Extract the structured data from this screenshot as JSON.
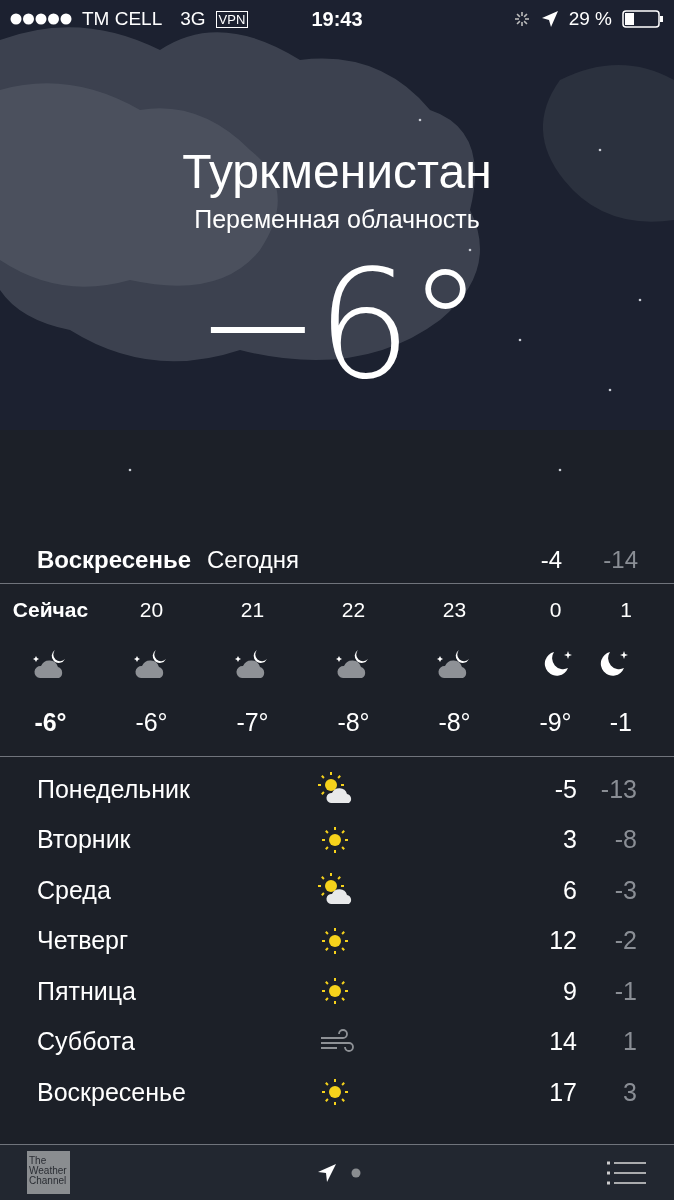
{
  "status_bar": {
    "carrier": "TM CELL",
    "network": "3G",
    "vpn": "VPN",
    "time": "19:43",
    "battery": "29 %"
  },
  "location": {
    "city": "Туркменистан",
    "condition": "Переменная облачность",
    "temperature": "−6°"
  },
  "today": {
    "day": "Воскресенье",
    "label": "Сегодня",
    "high": "-4",
    "low": "-14"
  },
  "hourly": [
    {
      "time": "Сейчас",
      "kind": "partly-cloudy-night",
      "temp": "-6°",
      "now": true
    },
    {
      "time": "20",
      "kind": "partly-cloudy-night",
      "temp": "-6°",
      "now": false
    },
    {
      "time": "21",
      "kind": "partly-cloudy-night",
      "temp": "-7°",
      "now": false
    },
    {
      "time": "22",
      "kind": "partly-cloudy-night",
      "temp": "-8°",
      "now": false
    },
    {
      "time": "23",
      "kind": "partly-cloudy-night",
      "temp": "-8°",
      "now": false
    },
    {
      "time": "0",
      "kind": "clear-night",
      "temp": "-9°",
      "now": false
    },
    {
      "time": "1",
      "kind": "clear-night",
      "temp": "-1",
      "now": false
    }
  ],
  "daily": [
    {
      "day": "Понедельник",
      "kind": "partly-sunny",
      "high": "-5",
      "low": "-13"
    },
    {
      "day": "Вторник",
      "kind": "sunny",
      "high": "3",
      "low": "-8"
    },
    {
      "day": "Среда",
      "kind": "partly-sunny",
      "high": "6",
      "low": "-3"
    },
    {
      "day": "Четверг",
      "kind": "sunny",
      "high": "12",
      "low": "-2"
    },
    {
      "day": "Пятница",
      "kind": "sunny",
      "high": "9",
      "low": "-1"
    },
    {
      "day": "Суббота",
      "kind": "windy",
      "high": "14",
      "low": "1"
    },
    {
      "day": "Воскресенье",
      "kind": "sunny",
      "high": "17",
      "low": "3"
    }
  ],
  "footer": {
    "logo": "The Weather Channel"
  }
}
